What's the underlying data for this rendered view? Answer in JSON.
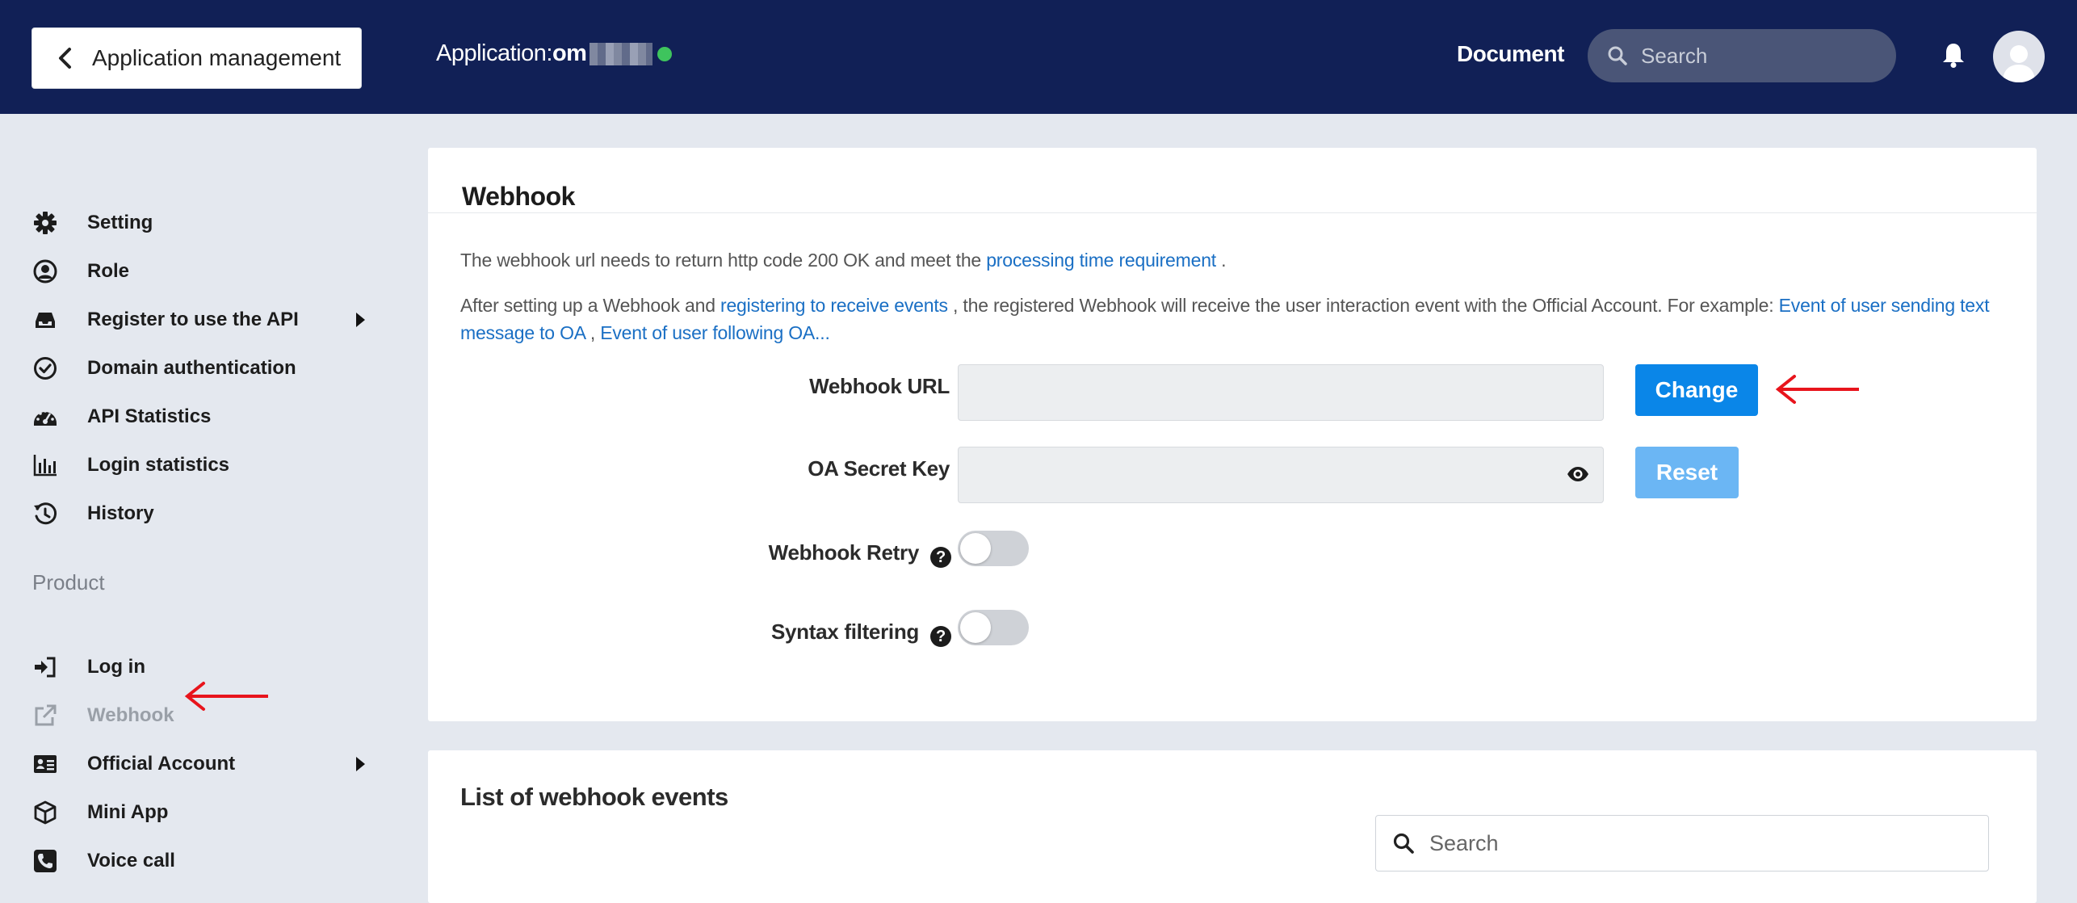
{
  "header": {
    "back_label": "Application management",
    "app_label_prefix": "Application:",
    "app_name_visible": "om",
    "document_label": "Document",
    "search_placeholder": "Search",
    "status_color": "#3ec45d"
  },
  "sidebar": {
    "items": [
      {
        "label": "Setting",
        "icon": "gear-icon"
      },
      {
        "label": "Role",
        "icon": "user-circle-icon"
      },
      {
        "label": "Register to use the API",
        "icon": "inbox-icon",
        "has_submenu": true
      },
      {
        "label": "Domain authentication",
        "icon": "check-circle-icon"
      },
      {
        "label": "API Statistics",
        "icon": "dashboard-icon"
      },
      {
        "label": "Login statistics",
        "icon": "bar-chart-icon"
      },
      {
        "label": "History",
        "icon": "history-icon"
      }
    ],
    "section_label": "Product",
    "product_items": [
      {
        "label": "Log in",
        "icon": "sign-in-icon"
      },
      {
        "label": "Webhook",
        "icon": "external-link-icon",
        "active": true
      },
      {
        "label": "Official Account",
        "icon": "id-card-icon",
        "has_submenu": true
      },
      {
        "label": "Mini App",
        "icon": "cube-icon"
      },
      {
        "label": "Voice call",
        "icon": "phone-icon"
      }
    ]
  },
  "webhook": {
    "title": "Webhook",
    "desc1_text": "The webhook url needs to return http code 200 OK and meet the ",
    "desc1_link": "processing time requirement",
    "desc1_end": " .",
    "desc2_text1": "After setting up a Webhook and ",
    "desc2_link1": "registering to receive events",
    "desc2_text2": " , the registered Webhook will receive the user interaction event with the Official Account. For example: ",
    "desc2_link2": "Event of user sending text message to OA",
    "desc2_text3": " , ",
    "desc2_link3": "Event of user following OA...",
    "url_label": "Webhook URL",
    "url_value": "",
    "change_label": "Change",
    "secret_label": "OA Secret Key",
    "secret_value": "",
    "reset_label": "Reset",
    "retry_label": "Webhook Retry",
    "retry_on": false,
    "syntax_label": "Syntax filtering",
    "syntax_on": false,
    "help_glyph": "?"
  },
  "events": {
    "title": "List of webhook events",
    "search_placeholder": "Search"
  },
  "colors": {
    "header_bg": "#112056",
    "primary": "#0a86e8",
    "primary_disabled": "#6bb6f4",
    "annotation_arrow": "#e8141c"
  }
}
